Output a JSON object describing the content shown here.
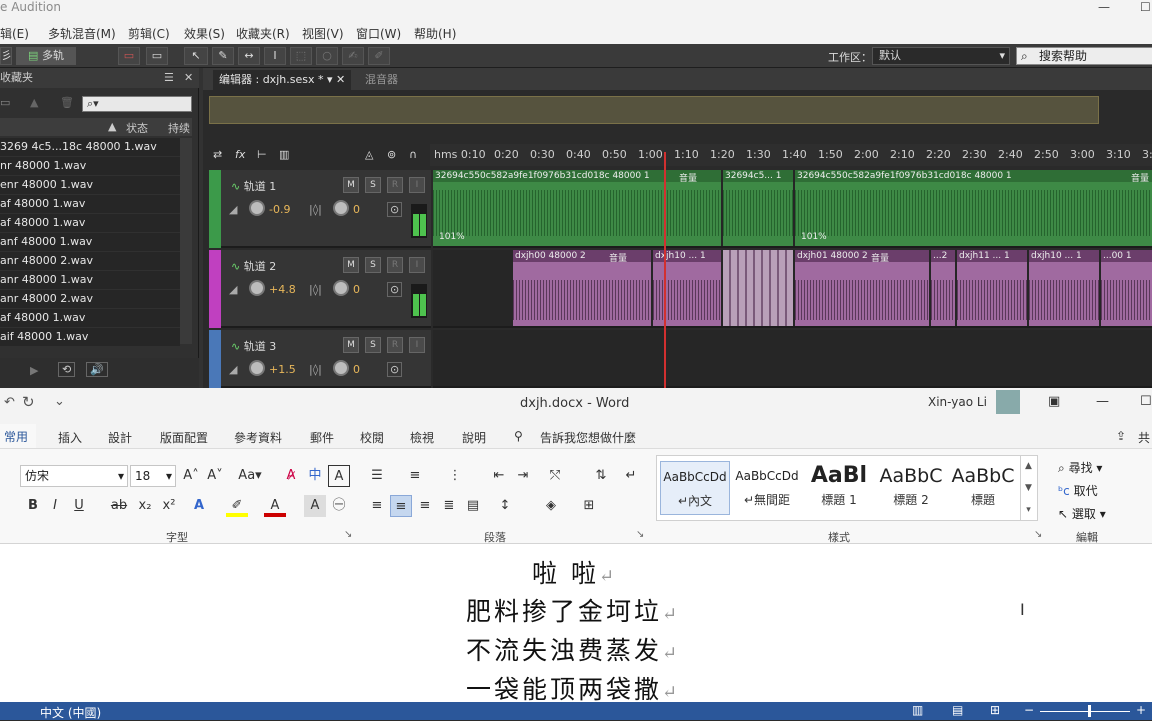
{
  "audition": {
    "title": "e Audition",
    "menu": [
      "辑(E)",
      "多轨混音(M)",
      "剪辑(C)",
      "效果(S)",
      "收藏夹(R)",
      "视图(V)",
      "窗口(W)",
      "帮助(H)"
    ],
    "toolbar": {
      "multitrack": "多轨",
      "workspace_label": "工作区：",
      "workspace_value": "默认",
      "help_placeholder": "搜索帮助"
    },
    "left_panel": {
      "title": "收藏夹",
      "columns": [
        "状态",
        "持续"
      ],
      "files": [
        "3269 4c5...18c 48000 1.wav",
        "nr 48000 1.wav",
        "enr 48000 1.wav",
        "af 48000 1.wav",
        "af 48000 1.wav",
        "anf 48000 1.wav",
        "anr 48000 2.wav",
        "anr 48000 1.wav",
        "anr 48000 2.wav",
        "af 48000 1.wav",
        "aif 48000 1.wav"
      ]
    },
    "editor": {
      "tab": "编辑器 : dxjh.sesx *",
      "mixer_tab": "混音器",
      "ruler": [
        "hms 0:10",
        "0:20",
        "0:30",
        "0:40",
        "0:50",
        "1:00",
        "1:10",
        "1:20",
        "1:30",
        "1:40",
        "1:50",
        "2:00",
        "2:10",
        "2:20",
        "2:30",
        "2:40",
        "2:50",
        "3:00",
        "3:10",
        "3:2"
      ],
      "tracks": [
        {
          "name": "轨道 1",
          "volume": "-0.9",
          "pan": "0",
          "color": "#3c9a4a"
        },
        {
          "name": "轨道 2",
          "volume": "+4.8",
          "pan": "0",
          "color": "#c040c0"
        },
        {
          "name": "轨道 3",
          "volume": "+1.5",
          "pan": "0",
          "color": "#4a78b8"
        }
      ],
      "clips1": [
        {
          "label": "32694c550c582a9fe1f0976b31cd018c 48000 1",
          "vol": "音量",
          "pct": "101%"
        },
        {
          "label": "32694c5... 1",
          "vol": "",
          "pct": ""
        },
        {
          "label": "32694c550c582a9fe1f0976b31cd018c 48000 1",
          "vol": "音量",
          "pct": "101%"
        }
      ],
      "clips2": [
        {
          "label": "dxjh00 48000 2",
          "vol": "音量"
        },
        {
          "label": "dxjh10 ... 1",
          "vol": ""
        },
        {
          "label": "dxjh01 48000 2",
          "vol": "音量"
        },
        {
          "label": "...2",
          "vol": ""
        },
        {
          "label": "dxjh11 ... 1",
          "vol": ""
        },
        {
          "label": "dxjh10 ... 1",
          "vol": ""
        },
        {
          "label": "...00 1",
          "vol": ""
        }
      ]
    }
  },
  "word": {
    "title": "dxjh.docx  -  Word",
    "user": "Xin-yao Li",
    "tabs": [
      "常用",
      "插入",
      "設計",
      "版面配置",
      "參考資料",
      "郵件",
      "校閱",
      "檢視",
      "說明",
      "告訴我您想做什麼",
      "共"
    ],
    "font_name": "仿宋",
    "font_size": "18",
    "groups": [
      "字型",
      "段落",
      "樣式",
      "編輯"
    ],
    "styles": [
      {
        "preview": "AaBbCcDd",
        "name": "↵內文"
      },
      {
        "preview": "AaBbCcDd",
        "name": "↵無間距"
      },
      {
        "preview": "AaBl",
        "name": "標題 1"
      },
      {
        "preview": "AaBbC",
        "name": "標題 2"
      },
      {
        "preview": "AaBbC",
        "name": "標題"
      }
    ],
    "editing": [
      "尋找",
      "取代",
      "選取"
    ],
    "doc_lines": [
      "啦 啦",
      "肥料掺了金坷垃",
      "不流失浊费蒸发",
      "一袋能顶两袋撒"
    ],
    "status_lang": "中文 (中國)"
  }
}
